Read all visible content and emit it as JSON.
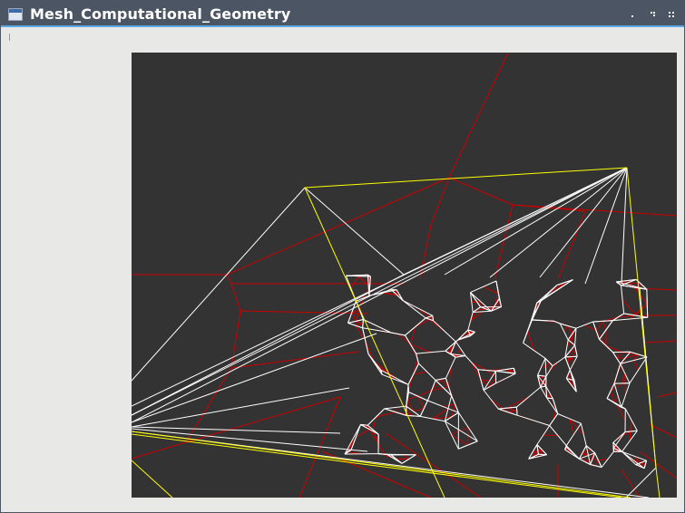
{
  "window": {
    "title": "Mesh_Computational_Geometry",
    "buttons": {
      "minimize_icon": "minimize-icon",
      "maximize_icon": "maximize-icon",
      "close_icon": "close-icon"
    }
  },
  "colors": {
    "titlebar": "#4b5563",
    "titlebar_accent": "#5aa9e6",
    "window_bg": "#e8e8e7",
    "canvas_bg": "#333333",
    "delaunay_edges": "#ffffff",
    "voronoi_edges": "#cc0000",
    "convex_hull": "#ffff00"
  },
  "canvas": {
    "icon": "mesh-viewport"
  }
}
